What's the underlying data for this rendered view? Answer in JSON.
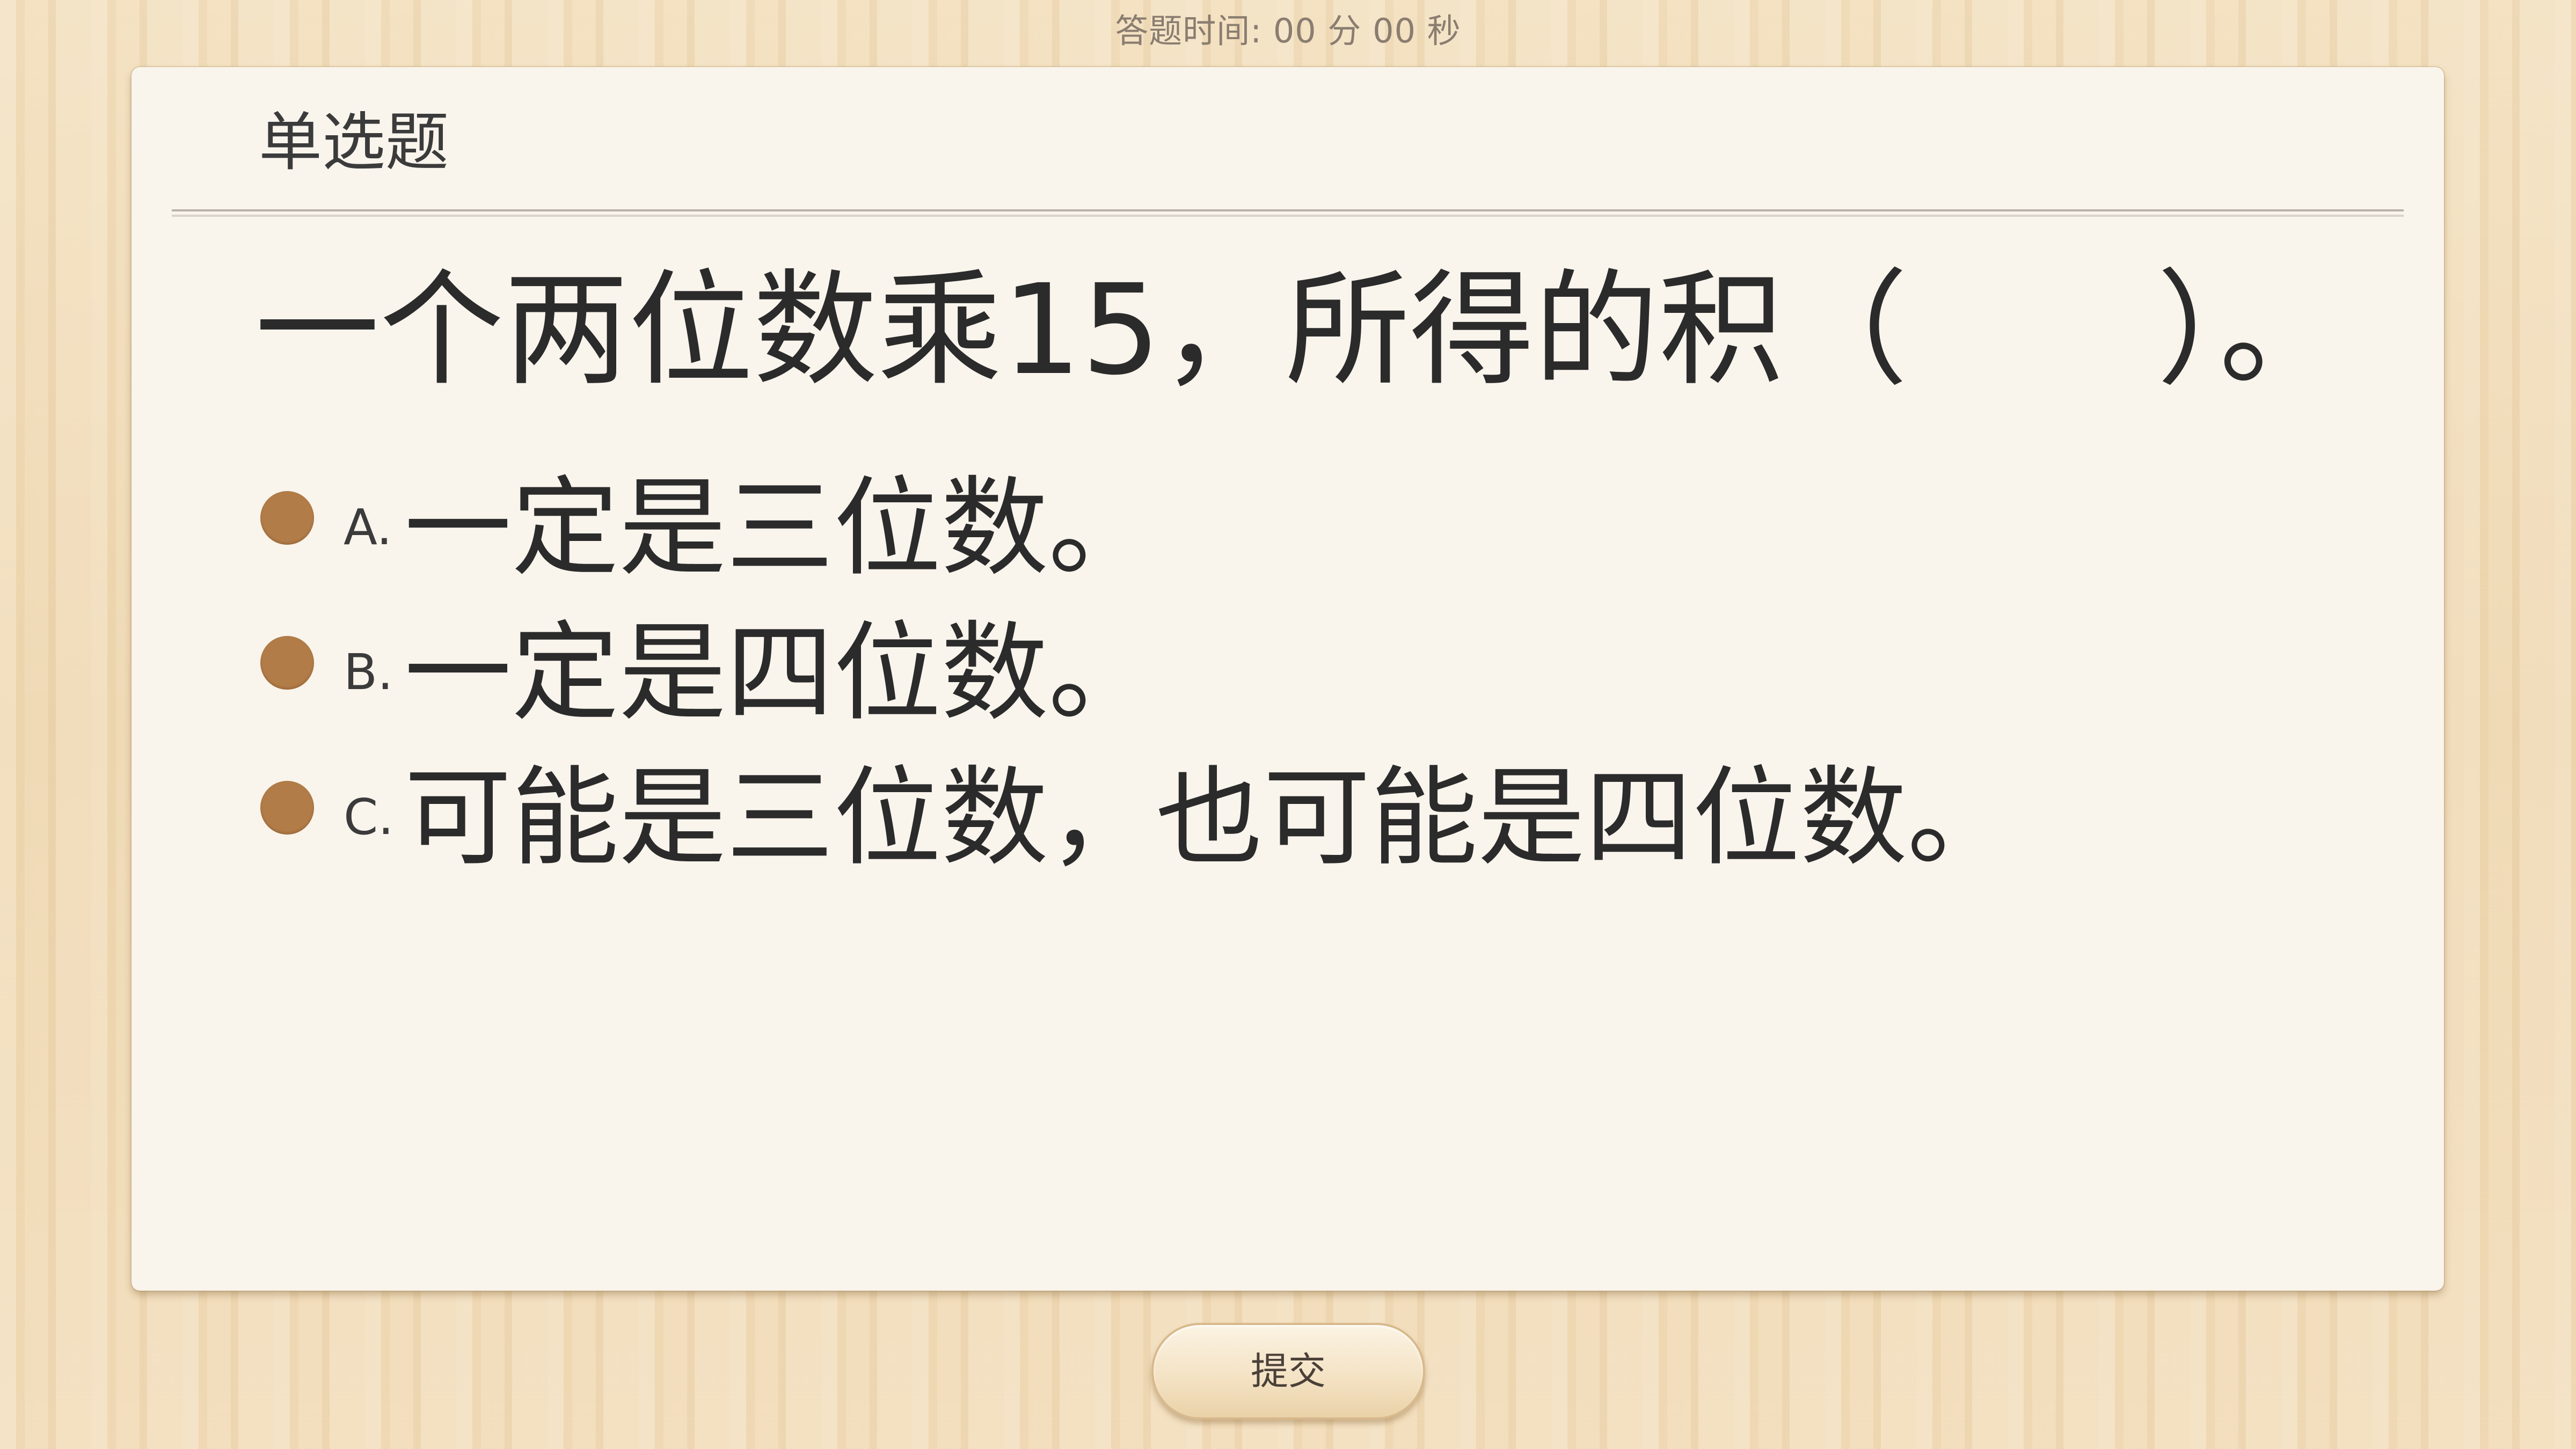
{
  "timer": {
    "text": "答题时间:  00 分 00 秒"
  },
  "question": {
    "type_label": "单选题",
    "stem": "一个两位数乘15，所得的积（　　）。",
    "options": [
      {
        "letter": "A.",
        "text": "一定是三位数。"
      },
      {
        "letter": "B.",
        "text": "一定是四位数。"
      },
      {
        "letter": "C.",
        "text": "可能是三位数，也可能是四位数。"
      }
    ]
  },
  "submit": {
    "label": "提交"
  },
  "colors": {
    "radio": "#b17c48",
    "card_bg": "#f9f4ec",
    "wood_bg": "#f1dcb9"
  }
}
